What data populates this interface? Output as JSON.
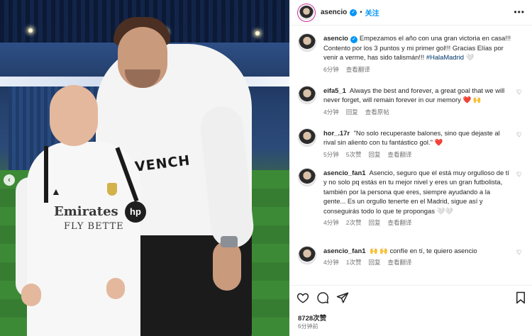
{
  "post": {
    "author": "asencio",
    "follow_label": "关注",
    "caption_text": "Empezamos el año con una gran victoria en casa!!! Contento por los 3 puntos y mi primer gol!!! Gracias Elías por venir a verme, has sido talismán!!!",
    "caption_tag": "#HalaMadrid",
    "caption_emoji": "🤍",
    "caption_time": "6分钟",
    "see_translation": "查看翻译",
    "likes": "8728次赞",
    "time_ago": "6分钟前"
  },
  "photo": {
    "jersey_sponsor": "Emirates",
    "jersey_sponsor_sub": "FLY BETTE",
    "hoodie_text": "VENCH",
    "sleeve_logo": "hp"
  },
  "comments": [
    {
      "user": "eifa5_1",
      "text": "Always the best and forever, a great goal that we will never forget, will remain forever in our memory",
      "emoji": "❤️ 🙌",
      "time": "4分钟",
      "reply": "回复",
      "translation": "查看原帖"
    },
    {
      "user": "hor_.17r",
      "text": "\"No solo recuperaste balones, sino que dejaste al rival sin aliento con tu fantástico gol.\"",
      "emoji": "❤️",
      "time": "5分钟",
      "likes": "5次赞",
      "reply": "回复",
      "translation": "查看翻译"
    },
    {
      "user": "asencio_fan1",
      "text": "Asencio, seguro que el está muy orgulloso de tí y no solo pq estás en tu mejor nivel y eres un gran futbolista, también por la persona que eres, siempre ayudando a la gente... Es un orgullo tenerte en el Madrid, sigue así y conseguirás todo lo que te propongas",
      "emoji": "🤍🤍",
      "time": "4分钟",
      "likes": "2次赞",
      "reply": "回复",
      "translation": "查看翻译"
    },
    {
      "user": "asencio_fan1",
      "text": "confíe en tí, te quiero asencio",
      "emoji_before": "🙌 🙌",
      "time": "4分钟",
      "likes": "1次赞",
      "reply": "回复",
      "translation": "查看翻译"
    }
  ],
  "icons": {
    "like": "heart-icon",
    "comment": "comment-icon",
    "share": "share-icon",
    "save": "bookmark-icon",
    "more": "more-icon",
    "prev": "chevron-left-icon"
  },
  "colors": {
    "accent": "#0095f6",
    "heart_red": "#e0245e"
  }
}
